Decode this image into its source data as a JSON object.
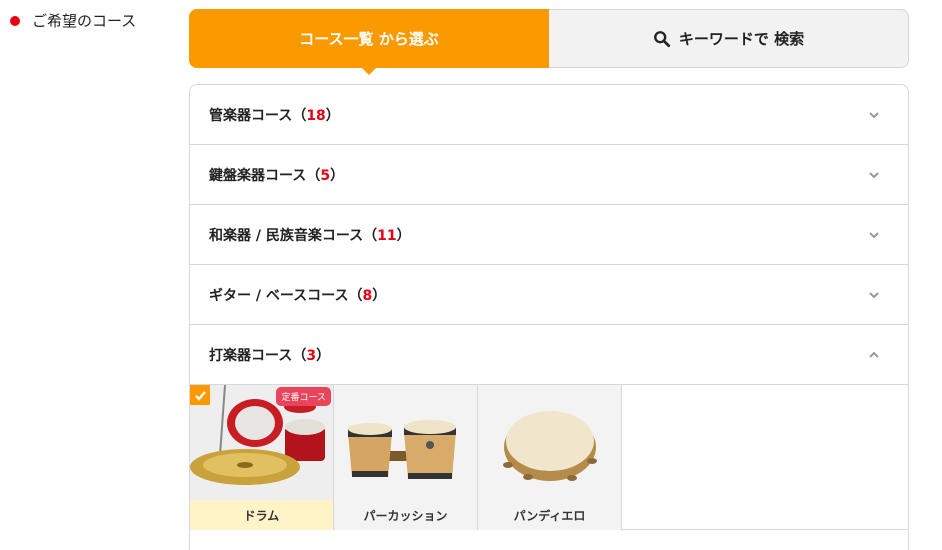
{
  "side": {
    "label": "ご希望のコース"
  },
  "tabs": {
    "list_label": "コース一覧 から選ぶ",
    "search_label": "キーワードで 検索"
  },
  "categories": [
    {
      "name": "管楽器コース",
      "open": "（",
      "count": "18",
      "close": "）",
      "expanded": false
    },
    {
      "name": "鍵盤楽器コース",
      "open": "（",
      "count": "5",
      "close": "）",
      "expanded": false
    },
    {
      "name": "和楽器 / 民族音楽コース",
      "open": "（",
      "count": "11",
      "close": "）",
      "expanded": false
    },
    {
      "name": "ギター / ベースコース",
      "open": "（",
      "count": "8",
      "close": "）",
      "expanded": false
    },
    {
      "name": "打楽器コース",
      "open": "（",
      "count": "3",
      "close": "）",
      "expanded": true
    }
  ],
  "courses": [
    {
      "name": "ドラム",
      "badge": "定番コース",
      "selected": true,
      "icon": "drum-kit-image"
    },
    {
      "name": "パーカッション",
      "selected": false,
      "icon": "bongo-image"
    },
    {
      "name": "パンディエロ",
      "selected": false,
      "icon": "tambourine-image"
    }
  ],
  "colors": {
    "accent": "#fb9a00",
    "count_red": "#e60012",
    "badge": "#e8455d"
  }
}
